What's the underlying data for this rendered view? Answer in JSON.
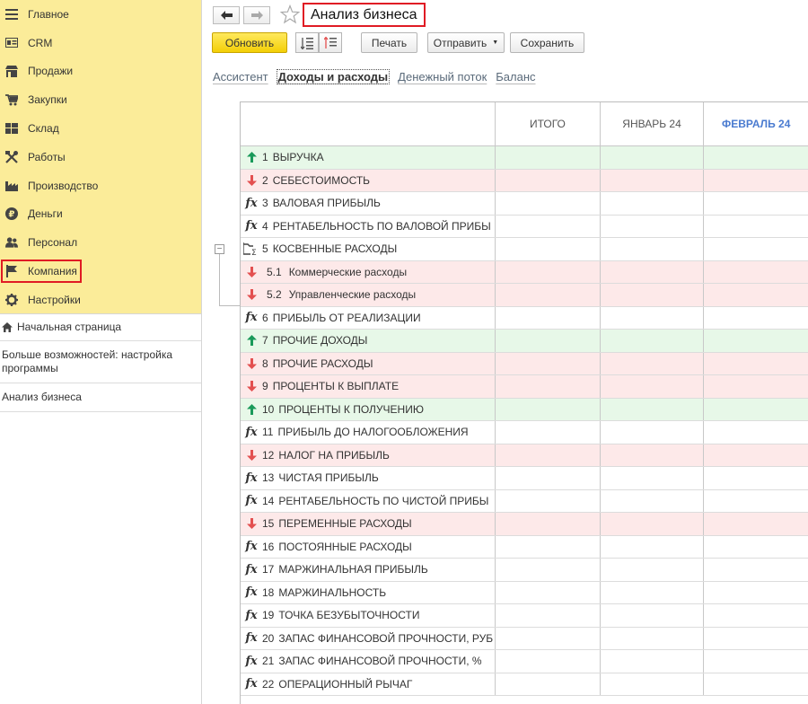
{
  "sidebar": {
    "sections": [
      {
        "label": "Главное",
        "icon": "menu-icon"
      },
      {
        "label": "CRM",
        "icon": "contact-card-icon"
      },
      {
        "label": "Продажи",
        "icon": "shop-icon"
      },
      {
        "label": "Закупки",
        "icon": "cart-icon"
      },
      {
        "label": "Склад",
        "icon": "warehouse-icon"
      },
      {
        "label": "Работы",
        "icon": "tools-icon"
      },
      {
        "label": "Производство",
        "icon": "factory-icon"
      },
      {
        "label": "Деньги",
        "icon": "ruble-coin-icon"
      },
      {
        "label": "Персонал",
        "icon": "people-icon"
      },
      {
        "label": "Компания",
        "icon": "flag-icon"
      },
      {
        "label": "Настройки",
        "icon": "gear-icon"
      }
    ],
    "nav": {
      "home": "Начальная страница",
      "more": "Больше возможностей: настройка программы",
      "current": "Анализ бизнеса"
    }
  },
  "header": {
    "title": "Анализ бизнеса",
    "back_icon": "arrow-left-icon",
    "forward_icon": "arrow-right-icon",
    "favorite_icon": "star-icon"
  },
  "toolbar": {
    "refresh": "Обновить",
    "print": "Печать",
    "send": "Отправить",
    "save": "Сохранить"
  },
  "tabs": [
    {
      "label": "Ассистент"
    },
    {
      "label": "Доходы и расходы"
    },
    {
      "label": "Денежный поток"
    },
    {
      "label": "Баланс"
    }
  ],
  "table": {
    "columns": [
      "ИТОГО",
      "ЯНВАРЬ 24",
      "ФЕВРАЛЬ 24"
    ],
    "rows": [
      {
        "num": "1",
        "label": "ВЫРУЧКА",
        "kind": "rev"
      },
      {
        "num": "2",
        "label": "СЕБЕСТОИМОСТЬ",
        "kind": "exp"
      },
      {
        "num": "3",
        "label": "ВАЛОВАЯ ПРИБЫЛЬ",
        "kind": "calc"
      },
      {
        "num": "4",
        "label": "РЕНТАБЕЛЬНОСТЬ ПО ВАЛОВОЙ ПРИБЫ",
        "kind": "calc"
      },
      {
        "num": "5",
        "label": "КОСВЕННЫЕ РАСХОДЫ",
        "kind": "group"
      },
      {
        "num": "5.1",
        "label": "Коммерческие расходы",
        "kind": "exp",
        "sub": true
      },
      {
        "num": "5.2",
        "label": "Управленческие расходы",
        "kind": "exp",
        "sub": true
      },
      {
        "num": "6",
        "label": "ПРИБЫЛЬ ОТ РЕАЛИЗАЦИИ",
        "kind": "calc"
      },
      {
        "num": "7",
        "label": "ПРОЧИЕ ДОХОДЫ",
        "kind": "rev"
      },
      {
        "num": "8",
        "label": "ПРОЧИЕ РАСХОДЫ",
        "kind": "exp"
      },
      {
        "num": "9",
        "label": "ПРОЦЕНТЫ К ВЫПЛАТЕ",
        "kind": "exp"
      },
      {
        "num": "10",
        "label": "ПРОЦЕНТЫ К ПОЛУЧЕНИЮ",
        "kind": "rev"
      },
      {
        "num": "11",
        "label": "ПРИБЫЛЬ ДО НАЛОГООБЛОЖЕНИЯ",
        "kind": "calc"
      },
      {
        "num": "12",
        "label": "НАЛОГ НА ПРИБЫЛЬ",
        "kind": "exp"
      },
      {
        "num": "13",
        "label": "ЧИСТАЯ ПРИБЫЛЬ",
        "kind": "calc"
      },
      {
        "num": "14",
        "label": "РЕНТАБЕЛЬНОСТЬ ПО ЧИСТОЙ ПРИБЫ",
        "kind": "calc"
      },
      {
        "num": "15",
        "label": "ПЕРЕМЕННЫЕ РАСХОДЫ",
        "kind": "exp"
      },
      {
        "num": "16",
        "label": "ПОСТОЯННЫЕ РАСХОДЫ",
        "kind": "calc"
      },
      {
        "num": "17",
        "label": "МАРЖИНАЛЬНАЯ ПРИБЫЛЬ",
        "kind": "calc"
      },
      {
        "num": "18",
        "label": "МАРЖИНАЛЬНОСТЬ",
        "kind": "calc"
      },
      {
        "num": "19",
        "label": "ТОЧКА БЕЗУБЫТОЧНОСТИ",
        "kind": "calc"
      },
      {
        "num": "20",
        "label": "ЗАПАС ФИНАНСОВОЙ ПРОЧНОСТИ, РУБ",
        "kind": "calc"
      },
      {
        "num": "21",
        "label": "ЗАПАС ФИНАНСОВОЙ ПРОЧНОСТИ, %",
        "kind": "calc"
      },
      {
        "num": "22",
        "label": "ОПЕРАЦИОННЫЙ РЫЧАГ",
        "kind": "calc"
      }
    ]
  },
  "colors": {
    "section_bg": "#fbec99",
    "revenue_row": "#e7f8e8",
    "expense_row": "#fde9e9",
    "up_arrow": "#1a9a5a",
    "down_arrow": "#e35050",
    "current_month": "#4a7bd0",
    "highlight": "#e01b24"
  }
}
